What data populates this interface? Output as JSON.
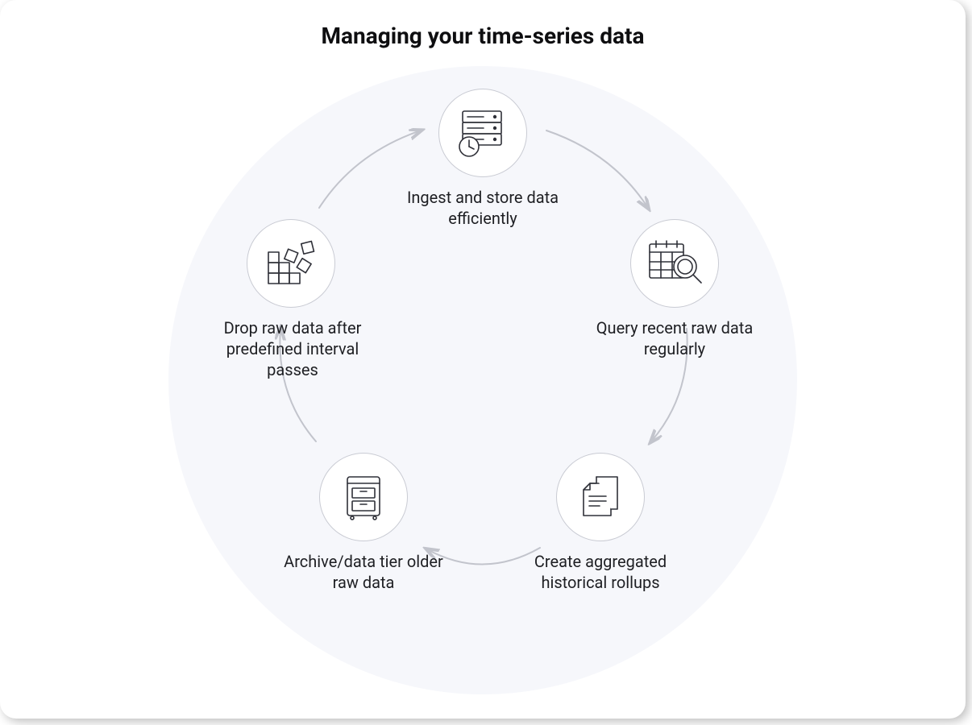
{
  "title": "Managing your time-series data",
  "stages": [
    {
      "id": "ingest",
      "label": "Ingest and store data efficiently"
    },
    {
      "id": "query",
      "label": "Query recent raw data regularly"
    },
    {
      "id": "rollup",
      "label": "Create aggregated historical rollups"
    },
    {
      "id": "archive",
      "label": "Archive/data tier older raw data"
    },
    {
      "id": "drop",
      "label": "Drop raw data after predefined interval passes"
    }
  ],
  "icons": {
    "ingest": "server-clock-icon",
    "query": "calendar-search-icon",
    "rollup": "documents-icon",
    "archive": "cabinet-icon",
    "drop": "blocks-falling-icon"
  },
  "colors": {
    "text": "#1e1f23",
    "icon": "#2f3038",
    "ring": "#c9cbd3",
    "arrow": "#c2c4cc",
    "cycle_bg": "#f6f7fb"
  }
}
